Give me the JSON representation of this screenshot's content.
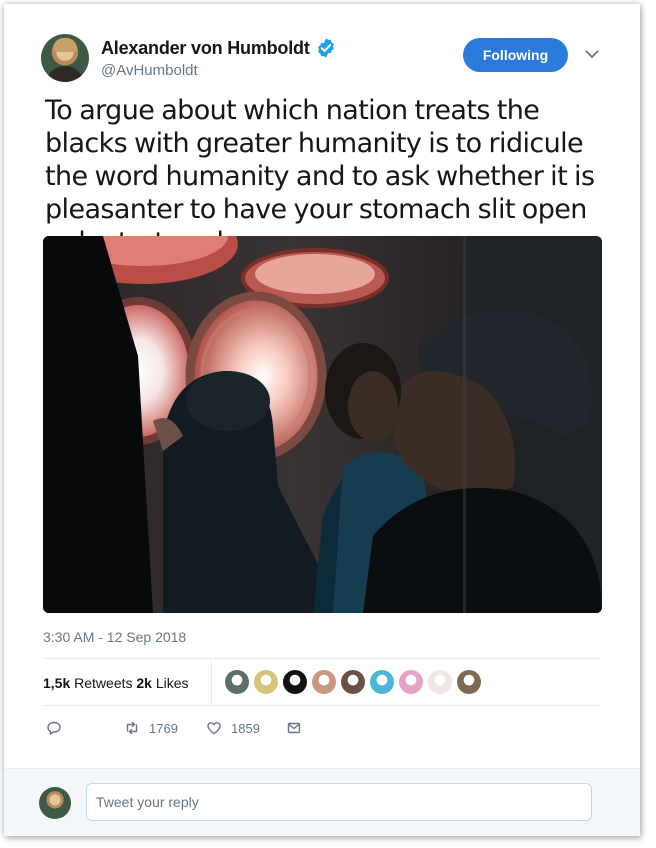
{
  "author": {
    "name": "Alexander von Humboldt",
    "handle": "@AvHumboldt",
    "verified": true
  },
  "follow_button": {
    "label": "Following"
  },
  "tweet": {
    "text": "To argue about which nation treats the blacks with greater humanity is to ridicule the word humanity and to ask whether it is pleasanter to have your stomach slit open or be tortured.",
    "timestamp": "3:30 AM - 12 Sep 2018"
  },
  "stats": {
    "retweets_count": "1,5k",
    "retweets_label": "Retweets",
    "likes_count": "2k",
    "likes_label": "Likes"
  },
  "likers": [
    {
      "color": "#5c6f68"
    },
    {
      "color": "#d9c37a"
    },
    {
      "color": "#111111"
    },
    {
      "color": "#c79a7f"
    },
    {
      "color": "#6b5144"
    },
    {
      "color": "#4db6d8"
    },
    {
      "color": "#e7a3c6"
    },
    {
      "color": "#efe7e3"
    },
    {
      "color": "#7d6a55"
    }
  ],
  "actions": {
    "reply": {
      "icon": "reply-icon",
      "count": ""
    },
    "retweet": {
      "icon": "retweet-icon",
      "count": "1769"
    },
    "like": {
      "icon": "heart-icon",
      "count": "1859"
    },
    "dm": {
      "icon": "envelope-icon",
      "count": ""
    }
  },
  "reply": {
    "placeholder": "Tweet your reply"
  },
  "colors": {
    "accent": "#2b7bdc",
    "verified": "#1da1f2",
    "muted": "#657786"
  }
}
